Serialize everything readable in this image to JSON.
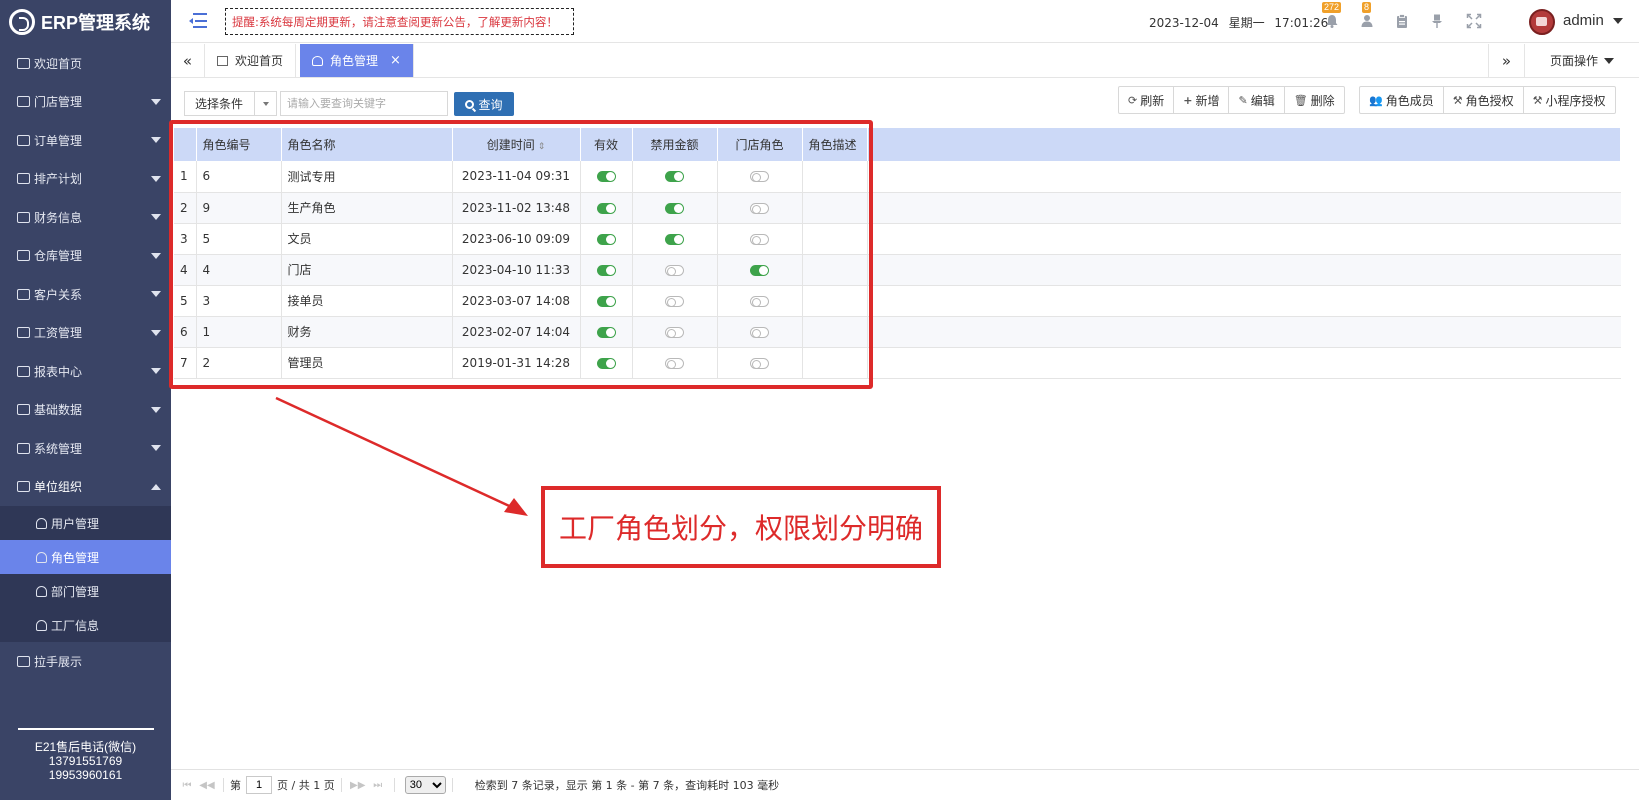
{
  "app": {
    "title": "ERP管理系统"
  },
  "header": {
    "notice": "提醒:系统每周定期更新，请注意查阅更新公告，了解更新内容！",
    "date": "2023-12-04",
    "weekday": "星期一",
    "time": "17:01:26",
    "notifications_count": "272",
    "users_count": "8",
    "username": "admin"
  },
  "sidebar": {
    "items": [
      {
        "label": "欢迎首页",
        "icon": "home-icon",
        "expandable": false
      },
      {
        "label": "门店管理",
        "icon": "store-icon",
        "expandable": true
      },
      {
        "label": "订单管理",
        "icon": "document-icon",
        "expandable": true
      },
      {
        "label": "排产计划",
        "icon": "document-icon",
        "expandable": true
      },
      {
        "label": "财务信息",
        "icon": "ledger-icon",
        "expandable": true
      },
      {
        "label": "仓库管理",
        "icon": "warehouse-icon",
        "expandable": true
      },
      {
        "label": "客户关系",
        "icon": "users-icon",
        "expandable": true
      },
      {
        "label": "工资管理",
        "icon": "ledger-icon",
        "expandable": true
      },
      {
        "label": "报表中心",
        "icon": "report-icon",
        "expandable": true
      },
      {
        "label": "基础数据",
        "icon": "monitor-icon",
        "expandable": true
      },
      {
        "label": "系统管理",
        "icon": "monitor-icon",
        "expandable": true
      },
      {
        "label": "单位组织",
        "icon": "user-icon",
        "expandable": true
      }
    ],
    "subitems": [
      {
        "label": "用户管理",
        "icon": "user-icon"
      },
      {
        "label": "角色管理",
        "icon": "user-icon"
      },
      {
        "label": "部门管理",
        "icon": "users-icon"
      },
      {
        "label": "工厂信息",
        "icon": "users-icon"
      }
    ],
    "extra_item": {
      "label": "拉手展示",
      "icon": "store-icon"
    },
    "footer": {
      "hotline": "E21售后电话(微信)",
      "phone1": "13791551769",
      "phone2": "19953960161"
    }
  },
  "tabs": {
    "items": [
      {
        "label": "欢迎首页",
        "icon": "home-icon"
      },
      {
        "label": "角色管理",
        "icon": "user-icon",
        "active": true
      }
    ],
    "page_ops": "页面操作"
  },
  "toolbar": {
    "condition": "选择条件",
    "search_placeholder": "请输入要查询关键字",
    "search_label": "查询",
    "buttons_a": [
      {
        "label": "刷新",
        "icon": "refresh-icon"
      },
      {
        "label": "新增",
        "icon": "plus-icon"
      },
      {
        "label": "编辑",
        "icon": "edit-icon"
      },
      {
        "label": "删除",
        "icon": "trash-icon"
      }
    ],
    "buttons_b": [
      {
        "label": "角色成员",
        "icon": "group-icon"
      },
      {
        "label": "角色授权",
        "icon": "gavel-icon"
      },
      {
        "label": "小程序授权",
        "icon": "gavel-icon"
      }
    ]
  },
  "table": {
    "columns": [
      "角色编号",
      "角色名称",
      "创建时间",
      "有效",
      "禁用金额",
      "门店角色",
      "角色描述"
    ],
    "rows": [
      {
        "index": "1",
        "code": "6",
        "name": "测试专用",
        "created": "2023-11-04 09:31",
        "valid": true,
        "disable_amount": true,
        "store_role": false,
        "desc": ""
      },
      {
        "index": "2",
        "code": "9",
        "name": "生产角色",
        "created": "2023-11-02 13:48",
        "valid": true,
        "disable_amount": true,
        "store_role": false,
        "desc": ""
      },
      {
        "index": "3",
        "code": "5",
        "name": "文员",
        "created": "2023-06-10 09:09",
        "valid": true,
        "disable_amount": true,
        "store_role": false,
        "desc": ""
      },
      {
        "index": "4",
        "code": "4",
        "name": "门店",
        "created": "2023-04-10 11:33",
        "valid": true,
        "disable_amount": false,
        "store_role": true,
        "desc": ""
      },
      {
        "index": "5",
        "code": "3",
        "name": "接单员",
        "created": "2023-03-07 14:08",
        "valid": true,
        "disable_amount": false,
        "store_role": false,
        "desc": ""
      },
      {
        "index": "6",
        "code": "1",
        "name": "财务",
        "created": "2023-02-07 14:04",
        "valid": true,
        "disable_amount": false,
        "store_role": false,
        "desc": ""
      },
      {
        "index": "7",
        "code": "2",
        "name": "管理员",
        "created": "2019-01-31 14:28",
        "valid": true,
        "disable_amount": false,
        "store_role": false,
        "desc": ""
      }
    ]
  },
  "annotation": {
    "callout": "工厂角色划分，权限划分明确",
    "color": "#dd2a2a"
  },
  "pager": {
    "page_prefix": "第",
    "page": "1",
    "page_suffix": "页 / 共 1 页",
    "page_size": "30",
    "summary": "检索到 7 条记录，显示 第 1 条 - 第 7 条，查询耗时 103 毫秒"
  },
  "colors": {
    "sidebar_bg": "#3a4466",
    "accent": "#6a84ea",
    "toggle_on": "#3ea34b",
    "header_row": "#ccd9f7"
  }
}
